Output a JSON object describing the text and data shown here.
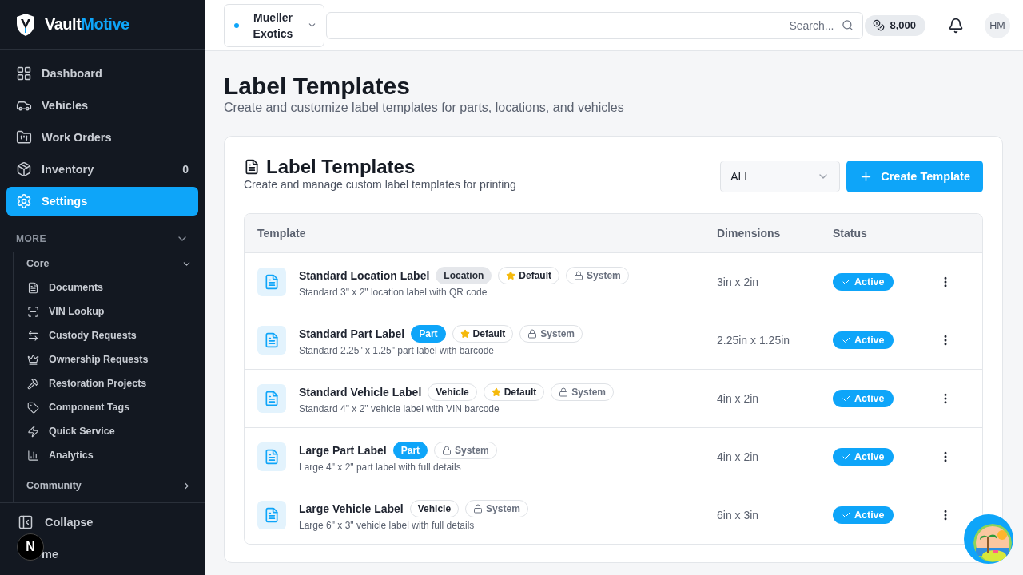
{
  "brand": {
    "first": "Vault",
    "second": "Motive"
  },
  "nav": [
    {
      "label": "Dashboard",
      "selected": false
    },
    {
      "label": "Vehicles",
      "selected": false
    },
    {
      "label": "Work Orders",
      "selected": false
    },
    {
      "label": "Inventory",
      "selected": false,
      "count": "0"
    },
    {
      "label": "Settings",
      "selected": true
    }
  ],
  "more": {
    "label": "MORE",
    "expanded": true,
    "groups": [
      {
        "label": "Core",
        "expanded": true,
        "items": [
          {
            "label": "Documents"
          },
          {
            "label": "VIN Lookup"
          },
          {
            "label": "Custody Requests"
          },
          {
            "label": "Ownership Requests"
          },
          {
            "label": "Restoration Projects"
          },
          {
            "label": "Component Tags"
          },
          {
            "label": "Quick Service"
          },
          {
            "label": "Analytics"
          }
        ]
      },
      {
        "label": "Community",
        "expanded": false
      }
    ]
  },
  "collapse": "Collapse",
  "theme": "me",
  "dev_badge": "N",
  "header": {
    "org": "Mueller Exotics",
    "search_placeholder": "Search...",
    "credits": "8,000",
    "avatar": "HM"
  },
  "page": {
    "title": "Label Templates",
    "subtitle": "Create and customize label templates for parts, locations, and vehicles"
  },
  "card": {
    "title": "Label Templates",
    "subtitle": "Create and manage custom label templates for printing",
    "filter": "ALL",
    "create": "Create Template"
  },
  "table": {
    "columns": [
      "Template",
      "Dimensions",
      "Status"
    ],
    "rows": [
      {
        "name": "Standard Location Label",
        "desc": "Standard 3\" x 2\" location label with QR code",
        "tags": [
          {
            "kind": "location",
            "label": "Location"
          },
          {
            "kind": "default",
            "label": "Default"
          },
          {
            "kind": "system",
            "label": "System"
          }
        ],
        "dimensions": "3in x 2in",
        "status": "Active"
      },
      {
        "name": "Standard Part Label",
        "desc": "Standard 2.25\" x 1.25\" part label with barcode",
        "tags": [
          {
            "kind": "part",
            "label": "Part"
          },
          {
            "kind": "default",
            "label": "Default"
          },
          {
            "kind": "system",
            "label": "System"
          }
        ],
        "dimensions": "2.25in x 1.25in",
        "status": "Active"
      },
      {
        "name": "Standard Vehicle Label",
        "desc": "Standard 4\" x 2\" vehicle label with VIN barcode",
        "tags": [
          {
            "kind": "vehicle",
            "label": "Vehicle"
          },
          {
            "kind": "default",
            "label": "Default"
          },
          {
            "kind": "system",
            "label": "System"
          }
        ],
        "dimensions": "4in x 2in",
        "status": "Active"
      },
      {
        "name": "Large Part Label",
        "desc": "Large 4\" x 2\" part label with full details",
        "tags": [
          {
            "kind": "part",
            "label": "Part"
          },
          {
            "kind": "system",
            "label": "System"
          }
        ],
        "dimensions": "4in x 2in",
        "status": "Active"
      },
      {
        "name": "Large Vehicle Label",
        "desc": "Large 6\" x 3\" vehicle label with full details",
        "tags": [
          {
            "kind": "vehicle",
            "label": "Vehicle"
          },
          {
            "kind": "system",
            "label": "System"
          }
        ],
        "dimensions": "6in x 3in",
        "status": "Active"
      }
    ]
  }
}
